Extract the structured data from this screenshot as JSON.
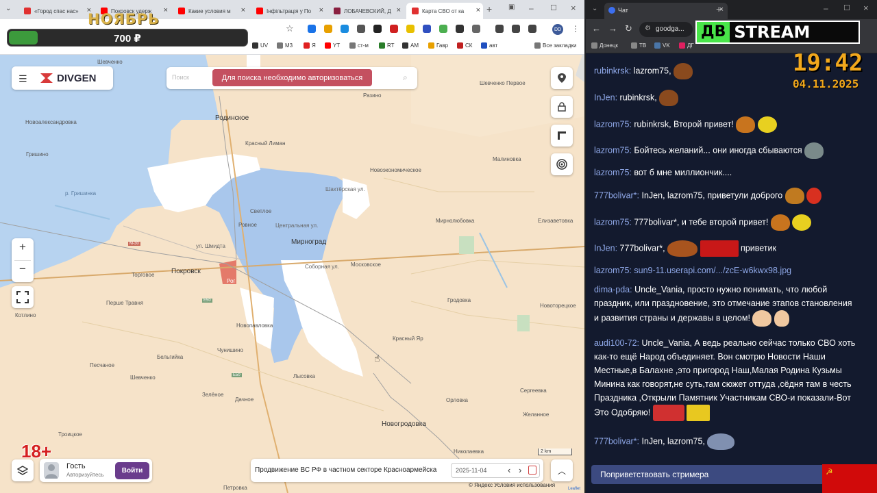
{
  "left_browser": {
    "tabs": [
      {
        "title": "«Город спас нас»",
        "favicon_color": "#e03030"
      },
      {
        "title": "Покровск удерж",
        "favicon_color": "#ff0000"
      },
      {
        "title": "Какие условия м",
        "favicon_color": "#ff0000"
      },
      {
        "title": "Інфільтрація у По",
        "favicon_color": "#ff0000"
      },
      {
        "title": "ЛОБАЧЕВСКИЙ, Д",
        "favicon_color": "#8a2040"
      },
      {
        "title": "Карта СВО от ка",
        "favicon_color": "#e03030"
      }
    ],
    "new_tab": "+",
    "bookmarks": [
      "UV",
      "M3",
      "Я",
      "YT",
      "ст-м",
      "RT",
      "AM",
      "Гавр",
      "СК",
      "авт"
    ],
    "all_bookmarks": "Все закладки",
    "profile": "DD"
  },
  "overlay": {
    "month": "НОЯБРЬ",
    "price": "700 ₽",
    "price_progress": 0.12,
    "age": "18+"
  },
  "map": {
    "logo": "DIVGEN",
    "search_placeholder": "Поиск",
    "search_notice": "Для поиска необходимо авторизоваться",
    "towns": [
      {
        "name": "Шевченко"
      },
      {
        "name": "Родинское",
        "big": true
      },
      {
        "name": "Новоалександровка"
      },
      {
        "name": "Красный Лиман"
      },
      {
        "name": "Гришино"
      },
      {
        "name": "р. Гришинка"
      },
      {
        "name": "Светлое"
      },
      {
        "name": "Ровное"
      },
      {
        "name": "Мирноград",
        "big": true
      },
      {
        "name": "Покровск",
        "big": true
      },
      {
        "name": "Торговое"
      },
      {
        "name": "Перше Травня"
      },
      {
        "name": "Котлино"
      },
      {
        "name": "Новопавловка"
      },
      {
        "name": "Чунишино"
      },
      {
        "name": "Бельгийка"
      },
      {
        "name": "Песчаное"
      },
      {
        "name": "Шевченко"
      },
      {
        "name": "Зелёное"
      },
      {
        "name": "Лысовка"
      },
      {
        "name": "Дачное"
      },
      {
        "name": "Троицкое"
      },
      {
        "name": "Новогродовка",
        "big": true
      },
      {
        "name": "Петровка"
      },
      {
        "name": "Разино"
      },
      {
        "name": "Новоэкономическое"
      },
      {
        "name": "Малиновка"
      },
      {
        "name": "Шевченко Первое"
      },
      {
        "name": "Мирнолюбовка"
      },
      {
        "name": "Елизаветовка"
      },
      {
        "name": "Московское"
      },
      {
        "name": "Гродовка"
      },
      {
        "name": "Красный Яр"
      },
      {
        "name": "Сергеевка"
      },
      {
        "name": "Орловка"
      },
      {
        "name": "Желанное"
      },
      {
        "name": "Николаевка"
      },
      {
        "name": "Новоторецкое"
      },
      {
        "name": "Рог"
      },
      {
        "name": "Шахтёрская ул."
      },
      {
        "name": "Центральная ул."
      },
      {
        "name": "Соборная ул."
      },
      {
        "name": "ул. Шмидта"
      },
      {
        "name": "М-30"
      },
      {
        "name": "Е50"
      },
      {
        "name": "Е50"
      }
    ],
    "zoom_in": "+",
    "zoom_out": "−",
    "guest_name": "Гость",
    "guest_sub": "Авторизуйтесь",
    "login": "Войти",
    "info_text": "Продвижение ВС РФ в частном секторе Красноармейска",
    "date": "2025-11-04",
    "scale": "2 km",
    "attribution": "© Яндекс Условия использования",
    "leaflet": "Leaflet"
  },
  "right_browser": {
    "tab_title": "Чат",
    "url": "goodga...",
    "bookmarks": [
      "Донецк",
      "ТВ",
      "VK",
      "ДГ"
    ],
    "stream_logo_a": "ДВ",
    "stream_logo_b": "STREAM",
    "clock": "19:42",
    "date": "04.11.2025"
  },
  "chat": [
    {
      "nick": "rubinkrsk:",
      "text": "lazrom75,"
    },
    {
      "nick": "InJen:",
      "text": "rubinkrsk,"
    },
    {
      "nick": "lazrom75:",
      "text": "rubinkrsk, Второй привет!"
    },
    {
      "nick": "lazrom75:",
      "text": "Бойтесь желаний... они иногда сбываются"
    },
    {
      "nick": "lazrom75:",
      "text": "вот б мне миллиончик...."
    },
    {
      "nick": "777bolivar*:",
      "text": "InJen, lazrom75, приветули доброго"
    },
    {
      "nick": "lazrom75:",
      "text": "777bolivar*, и тебе второй привет!"
    },
    {
      "nick": "InJen:",
      "text": "777bolivar*,"
    },
    {
      "nick": "",
      "text": "приветик"
    },
    {
      "nick": "lazrom75:",
      "text": "sun9-11.userapi.com/.../zcE-w6kwx98.jpg"
    },
    {
      "nick": "dima-pda:",
      "text": "Uncle_Vania, просто нужно понимать, что любой праздник, или праздновение, это отмечание этапов становления и развития страны и державы в целом!"
    },
    {
      "nick": "audi100-72:",
      "text": "Uncle_Vania, А ведь реально сейчас только СВО хоть как-то ещё Народ объединяет. Вон смотрю Новости Наши Местные,в Балахне ,это пригород Наш,Малая Родина Кузьмы Минина как говорят,не суть,там сюжет оттуда ,сёдня там в честь Праздника ,Открыли Памятник Участникам СВО-и показали-Вот Это Одобряю!"
    },
    {
      "nick": "777bolivar*:",
      "text": "InJen, lazrom75,"
    }
  ],
  "greet_button": "Поприветствовать стримера"
}
